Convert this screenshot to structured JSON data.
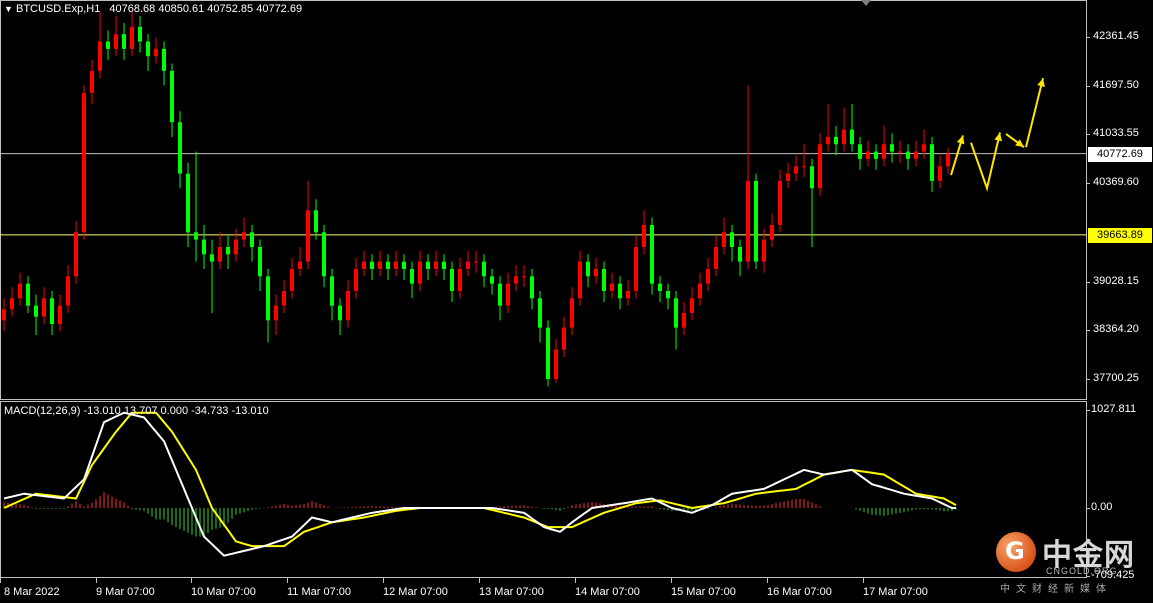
{
  "header": {
    "arrow": "▼",
    "symbol": "BTCUSD.Exp,H1",
    "ohlc_text": "40768.68 40850.61 40752.85 40772.69"
  },
  "macd_header": "MACD(12,26,9) -13.010 13.707 0.000 -34.733 -13.010",
  "colors": {
    "bull": "#ff0000",
    "bear": "#00ff00",
    "macd": "#ffffff",
    "signal": "#ffff00",
    "last_line": "#c0c0c0",
    "level_line": "#ffff66",
    "arrows": "#ffe600"
  },
  "watermark": {
    "icon": "coin-logo-icon",
    "name": "中金网",
    "domain": "CNGOLD.ORG",
    "slogan": "中文财经新媒体"
  },
  "chart_data": [
    {
      "type": "candlestick",
      "symbol": "BTCUSD.Exp",
      "timeframe": "H1",
      "ylim": [
        37441,
        42865
      ],
      "price_ticks": [
        42361.45,
        41697.5,
        41033.55,
        40369.6,
        39028.15,
        38364.2,
        37700.25
      ],
      "price_tick_labels": [
        "42361.45",
        "41697.50",
        "41033.55",
        "40369.60",
        "39028.15",
        "38364.20",
        "37700.25"
      ],
      "last_price": 40772.69,
      "last_price_label": "40772.69",
      "level_price": 39663.89,
      "level_price_label": "39663.89",
      "time_labels": [
        "8 Mar 2022",
        "9 Mar 07:00",
        "10 Mar 07:00",
        "11 Mar 07:00",
        "12 Mar 07:00",
        "13 Mar 07:00",
        "14 Mar 07:00",
        "15 Mar 07:00",
        "16 Mar 07:00",
        "17 Mar 07:00"
      ],
      "ohlc": [
        [
          38500,
          38800,
          38350,
          38650
        ],
        [
          38650,
          38950,
          38550,
          38800
        ],
        [
          38800,
          39150,
          38700,
          39000
        ],
        [
          39000,
          39100,
          38600,
          38700
        ],
        [
          38700,
          38850,
          38300,
          38550
        ],
        [
          38550,
          38950,
          38450,
          38800
        ],
        [
          38800,
          38900,
          38300,
          38450
        ],
        [
          38450,
          38850,
          38350,
          38700
        ],
        [
          38700,
          39250,
          38600,
          39100
        ],
        [
          39100,
          39850,
          39000,
          39700
        ],
        [
          39700,
          41700,
          39600,
          41600
        ],
        [
          41600,
          42050,
          41450,
          41900
        ],
        [
          41900,
          42700,
          41800,
          42300
        ],
        [
          42300,
          42450,
          42050,
          42200
        ],
        [
          42200,
          42650,
          42100,
          42400
        ],
        [
          42400,
          42550,
          42050,
          42200
        ],
        [
          42200,
          42700,
          42100,
          42500
        ],
        [
          42500,
          42650,
          42150,
          42300
        ],
        [
          42300,
          42400,
          41900,
          42100
        ],
        [
          42100,
          42350,
          42000,
          42200
        ],
        [
          42200,
          42300,
          41700,
          41900
        ],
        [
          41900,
          42000,
          41000,
          41200
        ],
        [
          41200,
          41350,
          40300,
          40500
        ],
        [
          40500,
          40650,
          39500,
          39700
        ],
        [
          39700,
          40800,
          39300,
          39600
        ],
        [
          39600,
          39800,
          39200,
          39400
        ],
        [
          39400,
          39600,
          38600,
          39300
        ],
        [
          39300,
          39700,
          39200,
          39500
        ],
        [
          39500,
          39650,
          39200,
          39400
        ],
        [
          39400,
          39750,
          39300,
          39600
        ],
        [
          39600,
          39900,
          39500,
          39700
        ],
        [
          39700,
          39800,
          39300,
          39500
        ],
        [
          39500,
          39600,
          38900,
          39100
        ],
        [
          39100,
          39200,
          38200,
          38500
        ],
        [
          38500,
          38850,
          38300,
          38700
        ],
        [
          38700,
          39050,
          38600,
          38900
        ],
        [
          38900,
          39350,
          38800,
          39200
        ],
        [
          39200,
          39500,
          39100,
          39300
        ],
        [
          39300,
          40400,
          39200,
          40000
        ],
        [
          40000,
          40150,
          39600,
          39700
        ],
        [
          39700,
          39800,
          38950,
          39100
        ],
        [
          39100,
          39200,
          38500,
          38700
        ],
        [
          38700,
          38800,
          38300,
          38500
        ],
        [
          38500,
          39050,
          38400,
          38900
        ],
        [
          38900,
          39350,
          38800,
          39200
        ],
        [
          39200,
          39450,
          39100,
          39300
        ],
        [
          39300,
          39400,
          39050,
          39200
        ],
        [
          39200,
          39450,
          39100,
          39300
        ],
        [
          39300,
          39400,
          39050,
          39200
        ],
        [
          39200,
          39450,
          39100,
          39300
        ],
        [
          39300,
          39400,
          39050,
          39200
        ],
        [
          39200,
          39300,
          38800,
          39000
        ],
        [
          39000,
          39450,
          38900,
          39300
        ],
        [
          39300,
          39400,
          39050,
          39200
        ],
        [
          39200,
          39450,
          39100,
          39300
        ],
        [
          39300,
          39400,
          39050,
          39200
        ],
        [
          39200,
          39300,
          38750,
          38900
        ],
        [
          38900,
          39350,
          38800,
          39200
        ],
        [
          39200,
          39450,
          39100,
          39300
        ],
        [
          39300,
          39450,
          39150,
          39300
        ],
        [
          39300,
          39400,
          38950,
          39100
        ],
        [
          39100,
          39200,
          38850,
          39000
        ],
        [
          39000,
          39100,
          38500,
          38700
        ],
        [
          38700,
          39150,
          38600,
          39000
        ],
        [
          39000,
          39250,
          38900,
          39100
        ],
        [
          39100,
          39250,
          38950,
          39100
        ],
        [
          39100,
          39200,
          38650,
          38800
        ],
        [
          38800,
          38900,
          38200,
          38400
        ],
        [
          38400,
          38500,
          37600,
          37700
        ],
        [
          37700,
          38250,
          37650,
          38100
        ],
        [
          38100,
          38550,
          38000,
          38400
        ],
        [
          38400,
          38950,
          38300,
          38800
        ],
        [
          38800,
          39450,
          38700,
          39300
        ],
        [
          39300,
          39400,
          38950,
          39100
        ],
        [
          39100,
          39350,
          39000,
          39200
        ],
        [
          39200,
          39300,
          38750,
          38900
        ],
        [
          38900,
          39150,
          38800,
          39000
        ],
        [
          39000,
          39100,
          38650,
          38800
        ],
        [
          38800,
          39050,
          38700,
          38900
        ],
        [
          38900,
          39650,
          38800,
          39500
        ],
        [
          39500,
          40000,
          39400,
          39800
        ],
        [
          39800,
          39900,
          38850,
          39000
        ],
        [
          39000,
          39100,
          38750,
          38900
        ],
        [
          38900,
          39000,
          38650,
          38800
        ],
        [
          38800,
          38900,
          38100,
          38400
        ],
        [
          38400,
          38750,
          38300,
          38600
        ],
        [
          38600,
          38950,
          38500,
          38800
        ],
        [
          38800,
          39150,
          38700,
          39000
        ],
        [
          39000,
          39350,
          38900,
          39200
        ],
        [
          39200,
          39650,
          39100,
          39500
        ],
        [
          39500,
          39900,
          39400,
          39700
        ],
        [
          39700,
          39800,
          39300,
          39500
        ],
        [
          39500,
          39600,
          39100,
          39300
        ],
        [
          39300,
          41700,
          39200,
          40400
        ],
        [
          40400,
          40500,
          39200,
          39300
        ],
        [
          39300,
          39750,
          39150,
          39600
        ],
        [
          39600,
          39950,
          39500,
          39800
        ],
        [
          39800,
          40550,
          39700,
          40400
        ],
        [
          40400,
          40650,
          40300,
          40500
        ],
        [
          40500,
          40750,
          40400,
          40600
        ],
        [
          40600,
          40900,
          40450,
          40600
        ],
        [
          40600,
          40700,
          39500,
          40300
        ],
        [
          40300,
          41050,
          40200,
          40900
        ],
        [
          40900,
          41450,
          40800,
          41000
        ],
        [
          41000,
          41150,
          40750,
          40900
        ],
        [
          40900,
          41400,
          40800,
          41100
        ],
        [
          41100,
          41450,
          40800,
          40900
        ],
        [
          40900,
          41000,
          40550,
          40700
        ],
        [
          40700,
          40950,
          40600,
          40800
        ],
        [
          40800,
          40900,
          40550,
          40700
        ],
        [
          40700,
          41150,
          40600,
          40900
        ],
        [
          40900,
          41050,
          40650,
          40800
        ],
        [
          40800,
          40950,
          40650,
          40800
        ],
        [
          40800,
          40900,
          40550,
          40700
        ],
        [
          40700,
          40950,
          40600,
          40800
        ],
        [
          40800,
          41100,
          40700,
          40900
        ],
        [
          40900,
          41000,
          40250,
          40400
        ],
        [
          40400,
          40750,
          40300,
          40600
        ],
        [
          40600,
          40850,
          40500,
          40770
        ]
      ]
    },
    {
      "type": "line",
      "indicator": "MACD(12,26,9)",
      "ylim": [
        -750,
        1100
      ],
      "y_ticks": [
        1027.811,
        0.0,
        -709.425
      ],
      "y_tick_labels": [
        "1027.811",
        "0.00",
        "-709.425"
      ],
      "macd": [
        [
          0,
          100
        ],
        [
          2.5,
          150
        ],
        [
          7.5,
          100
        ],
        [
          10,
          300
        ],
        [
          12.5,
          900
        ],
        [
          15,
          1000
        ],
        [
          17.5,
          950
        ],
        [
          20,
          700
        ],
        [
          22.5,
          200
        ],
        [
          25,
          -300
        ],
        [
          27.5,
          -500
        ],
        [
          30,
          -450
        ],
        [
          32.5,
          -400
        ],
        [
          36,
          -300
        ],
        [
          38.5,
          -100
        ],
        [
          41,
          -150
        ],
        [
          43.5,
          -100
        ],
        [
          46,
          -50
        ],
        [
          50,
          0
        ],
        [
          56,
          0
        ],
        [
          61,
          0
        ],
        [
          65,
          -50
        ],
        [
          67.5,
          -200
        ],
        [
          69.5,
          -250
        ],
        [
          71,
          -150
        ],
        [
          73.5,
          0
        ],
        [
          77.5,
          50
        ],
        [
          81,
          100
        ],
        [
          83.5,
          0
        ],
        [
          86,
          -50
        ],
        [
          88.5,
          30
        ],
        [
          91,
          150
        ],
        [
          95,
          200
        ],
        [
          97.5,
          300
        ],
        [
          100,
          400
        ],
        [
          102.5,
          350
        ],
        [
          106,
          400
        ],
        [
          108.5,
          250
        ],
        [
          112.5,
          150
        ],
        [
          116,
          100
        ],
        [
          118.5,
          0
        ]
      ],
      "signal": [
        [
          0,
          0
        ],
        [
          4,
          150
        ],
        [
          9,
          100
        ],
        [
          11,
          450
        ],
        [
          14,
          800
        ],
        [
          16,
          1000
        ],
        [
          19,
          1000
        ],
        [
          21,
          800
        ],
        [
          24,
          400
        ],
        [
          26,
          0
        ],
        [
          29,
          -350
        ],
        [
          31,
          -400
        ],
        [
          35,
          -400
        ],
        [
          37.5,
          -250
        ],
        [
          41,
          -150
        ],
        [
          45,
          -100
        ],
        [
          49,
          -30
        ],
        [
          52,
          0
        ],
        [
          60,
          0
        ],
        [
          65,
          -100
        ],
        [
          68,
          -200
        ],
        [
          71,
          -200
        ],
        [
          75,
          -50
        ],
        [
          79,
          50
        ],
        [
          82,
          80
        ],
        [
          86,
          0
        ],
        [
          90,
          50
        ],
        [
          94,
          150
        ],
        [
          99,
          200
        ],
        [
          102.5,
          350
        ],
        [
          106,
          400
        ],
        [
          110,
          350
        ],
        [
          114,
          150
        ],
        [
          117.5,
          100
        ],
        [
          119,
          30
        ]
      ]
    }
  ]
}
